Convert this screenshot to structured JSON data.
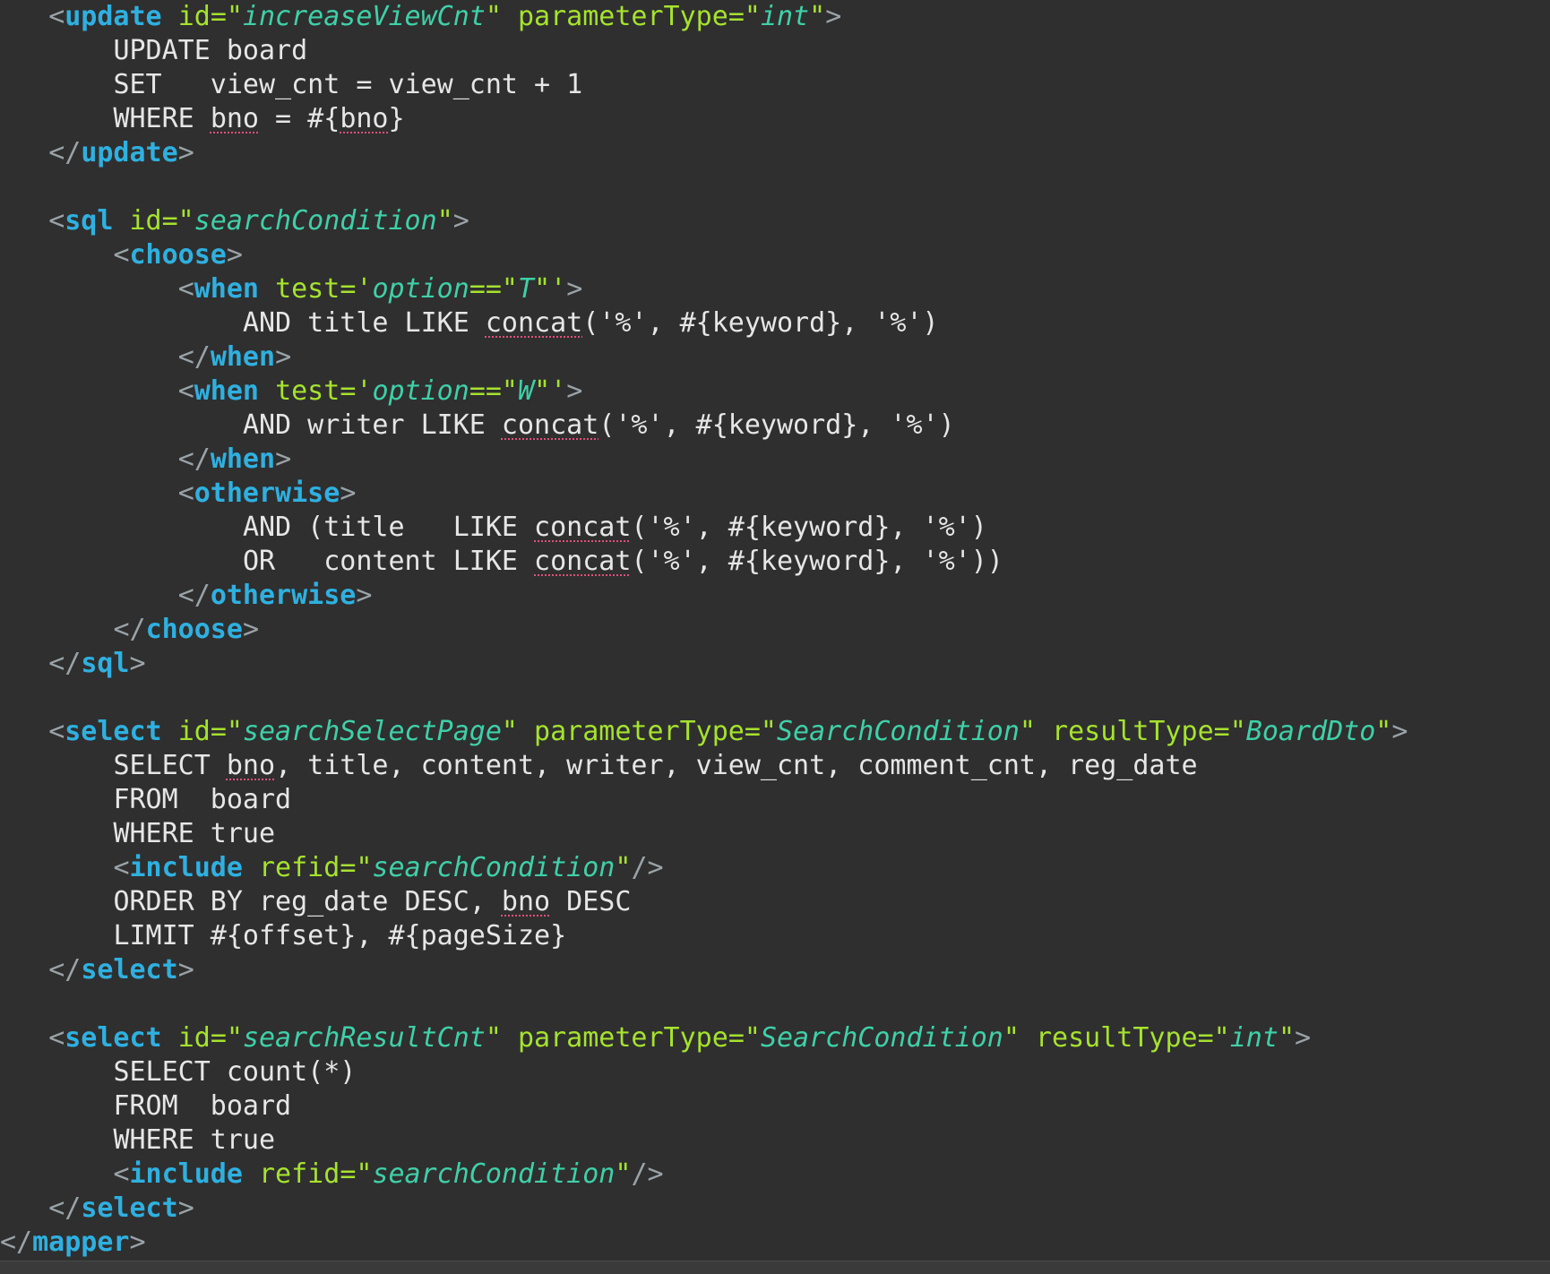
{
  "editor": {
    "theme": {
      "background": "#2f2f2f",
      "tag_color": "#2fb0e0",
      "attr_color": "#a6e22e",
      "value_color": "#3fd0a8",
      "text_color": "#e6e6e6",
      "bracket_color": "#9aa3a8",
      "warning_underline_color": "#e0507a"
    },
    "lines": [
      {
        "indent": 1,
        "tokens": [
          {
            "t": "br",
            "v": "<"
          },
          {
            "t": "tag",
            "v": "update"
          },
          {
            "t": "txt",
            "v": " "
          },
          {
            "t": "attr",
            "v": "id"
          },
          {
            "t": "eq",
            "v": "=\""
          },
          {
            "t": "val",
            "v": "increaseViewCnt"
          },
          {
            "t": "quote",
            "v": "\""
          },
          {
            "t": "txt",
            "v": " "
          },
          {
            "t": "attr",
            "v": "parameterType"
          },
          {
            "t": "eq",
            "v": "=\""
          },
          {
            "t": "val",
            "v": "int"
          },
          {
            "t": "quote",
            "v": "\""
          },
          {
            "t": "br",
            "v": ">"
          }
        ]
      },
      {
        "indent": 2,
        "tokens": [
          {
            "t": "txt",
            "v": "UPDATE board"
          }
        ]
      },
      {
        "indent": 2,
        "tokens": [
          {
            "t": "txt",
            "v": "SET   view_cnt = view_cnt + 1"
          }
        ]
      },
      {
        "indent": 2,
        "tokens": [
          {
            "t": "txt",
            "v": "WHERE "
          },
          {
            "t": "warn",
            "v": "bno"
          },
          {
            "t": "txt",
            "v": " = #{"
          },
          {
            "t": "warn",
            "v": "bno"
          },
          {
            "t": "txt",
            "v": "}"
          }
        ]
      },
      {
        "indent": 1,
        "tokens": [
          {
            "t": "br",
            "v": "</"
          },
          {
            "t": "tag",
            "v": "update"
          },
          {
            "t": "br",
            "v": ">"
          }
        ]
      },
      {
        "indent": 0,
        "tokens": []
      },
      {
        "indent": 1,
        "tokens": [
          {
            "t": "br",
            "v": "<"
          },
          {
            "t": "tag",
            "v": "sql"
          },
          {
            "t": "txt",
            "v": " "
          },
          {
            "t": "attr",
            "v": "id"
          },
          {
            "t": "eq",
            "v": "=\""
          },
          {
            "t": "val",
            "v": "searchCondition"
          },
          {
            "t": "quote",
            "v": "\""
          },
          {
            "t": "br",
            "v": ">"
          }
        ]
      },
      {
        "indent": 2,
        "tokens": [
          {
            "t": "br",
            "v": "<"
          },
          {
            "t": "tag",
            "v": "choose"
          },
          {
            "t": "br",
            "v": ">"
          }
        ]
      },
      {
        "indent": 3,
        "tokens": [
          {
            "t": "br",
            "v": "<"
          },
          {
            "t": "tag",
            "v": "when"
          },
          {
            "t": "txt",
            "v": " "
          },
          {
            "t": "attr",
            "v": "test"
          },
          {
            "t": "eq",
            "v": "='"
          },
          {
            "t": "val",
            "v": "option"
          },
          {
            "t": "eq",
            "v": "==\""
          },
          {
            "t": "val",
            "v": "T"
          },
          {
            "t": "eq",
            "v": "\"'"
          },
          {
            "t": "br",
            "v": ">"
          }
        ]
      },
      {
        "indent": 4,
        "tokens": [
          {
            "t": "txt",
            "v": "AND title LIKE "
          },
          {
            "t": "warn",
            "v": "concat"
          },
          {
            "t": "txt",
            "v": "('%', #{keyword}, '%')"
          }
        ]
      },
      {
        "indent": 3,
        "tokens": [
          {
            "t": "br",
            "v": "</"
          },
          {
            "t": "tag",
            "v": "when"
          },
          {
            "t": "br",
            "v": ">"
          }
        ]
      },
      {
        "indent": 3,
        "tokens": [
          {
            "t": "br",
            "v": "<"
          },
          {
            "t": "tag",
            "v": "when"
          },
          {
            "t": "txt",
            "v": " "
          },
          {
            "t": "attr",
            "v": "test"
          },
          {
            "t": "eq",
            "v": "='"
          },
          {
            "t": "val",
            "v": "option"
          },
          {
            "t": "eq",
            "v": "==\""
          },
          {
            "t": "val",
            "v": "W"
          },
          {
            "t": "eq",
            "v": "\"'"
          },
          {
            "t": "br",
            "v": ">"
          }
        ]
      },
      {
        "indent": 4,
        "tokens": [
          {
            "t": "txt",
            "v": "AND writer LIKE "
          },
          {
            "t": "warn",
            "v": "concat"
          },
          {
            "t": "txt",
            "v": "('%', #{keyword}, '%')"
          }
        ]
      },
      {
        "indent": 3,
        "tokens": [
          {
            "t": "br",
            "v": "</"
          },
          {
            "t": "tag",
            "v": "when"
          },
          {
            "t": "br",
            "v": ">"
          }
        ]
      },
      {
        "indent": 3,
        "tokens": [
          {
            "t": "br",
            "v": "<"
          },
          {
            "t": "tag",
            "v": "otherwise"
          },
          {
            "t": "br",
            "v": ">"
          }
        ]
      },
      {
        "indent": 4,
        "tokens": [
          {
            "t": "txt",
            "v": "AND (title   LIKE "
          },
          {
            "t": "warn",
            "v": "concat"
          },
          {
            "t": "txt",
            "v": "('%', #{keyword}, '%')"
          }
        ]
      },
      {
        "indent": 4,
        "tokens": [
          {
            "t": "txt",
            "v": "OR   content LIKE "
          },
          {
            "t": "warn",
            "v": "concat"
          },
          {
            "t": "txt",
            "v": "('%', #{keyword}, '%'))"
          }
        ]
      },
      {
        "indent": 3,
        "tokens": [
          {
            "t": "br",
            "v": "</"
          },
          {
            "t": "tag",
            "v": "otherwise"
          },
          {
            "t": "br",
            "v": ">"
          }
        ]
      },
      {
        "indent": 2,
        "tokens": [
          {
            "t": "br",
            "v": "</"
          },
          {
            "t": "tag",
            "v": "choose"
          },
          {
            "t": "br",
            "v": ">"
          }
        ]
      },
      {
        "indent": 1,
        "tokens": [
          {
            "t": "br",
            "v": "</"
          },
          {
            "t": "tag",
            "v": "sql"
          },
          {
            "t": "br",
            "v": ">"
          }
        ]
      },
      {
        "indent": 0,
        "tokens": []
      },
      {
        "indent": 1,
        "tokens": [
          {
            "t": "br",
            "v": "<"
          },
          {
            "t": "tag",
            "v": "select"
          },
          {
            "t": "txt",
            "v": " "
          },
          {
            "t": "attr",
            "v": "id"
          },
          {
            "t": "eq",
            "v": "=\""
          },
          {
            "t": "val",
            "v": "searchSelectPage"
          },
          {
            "t": "quote",
            "v": "\""
          },
          {
            "t": "txt",
            "v": " "
          },
          {
            "t": "attr",
            "v": "parameterType"
          },
          {
            "t": "eq",
            "v": "=\""
          },
          {
            "t": "val",
            "v": "SearchCondition"
          },
          {
            "t": "quote",
            "v": "\""
          },
          {
            "t": "txt",
            "v": " "
          },
          {
            "t": "attr",
            "v": "resultType"
          },
          {
            "t": "eq",
            "v": "=\""
          },
          {
            "t": "val",
            "v": "BoardDto"
          },
          {
            "t": "quote",
            "v": "\""
          },
          {
            "t": "br",
            "v": ">"
          }
        ]
      },
      {
        "indent": 2,
        "tokens": [
          {
            "t": "txt",
            "v": "SELECT "
          },
          {
            "t": "warn",
            "v": "bno"
          },
          {
            "t": "txt",
            "v": ", title, content, writer, view_cnt, comment_cnt, reg_date"
          }
        ]
      },
      {
        "indent": 2,
        "tokens": [
          {
            "t": "txt",
            "v": "FROM  board"
          }
        ]
      },
      {
        "indent": 2,
        "tokens": [
          {
            "t": "txt",
            "v": "WHERE true"
          }
        ]
      },
      {
        "indent": 2,
        "tokens": [
          {
            "t": "br",
            "v": "<"
          },
          {
            "t": "tag",
            "v": "include"
          },
          {
            "t": "txt",
            "v": " "
          },
          {
            "t": "attr",
            "v": "refid"
          },
          {
            "t": "eq",
            "v": "=\""
          },
          {
            "t": "val",
            "v": "searchCondition"
          },
          {
            "t": "quote",
            "v": "\""
          },
          {
            "t": "br",
            "v": "/>"
          }
        ]
      },
      {
        "indent": 2,
        "tokens": [
          {
            "t": "txt",
            "v": "ORDER BY reg_date DESC, "
          },
          {
            "t": "warn",
            "v": "bno"
          },
          {
            "t": "txt",
            "v": " DESC"
          }
        ]
      },
      {
        "indent": 2,
        "tokens": [
          {
            "t": "txt",
            "v": "LIMIT #{offset}, #{pageSize}"
          }
        ]
      },
      {
        "indent": 1,
        "tokens": [
          {
            "t": "br",
            "v": "</"
          },
          {
            "t": "tag",
            "v": "select"
          },
          {
            "t": "br",
            "v": ">"
          }
        ]
      },
      {
        "indent": 0,
        "tokens": []
      },
      {
        "indent": 1,
        "tokens": [
          {
            "t": "br",
            "v": "<"
          },
          {
            "t": "tag",
            "v": "select"
          },
          {
            "t": "txt",
            "v": " "
          },
          {
            "t": "attr",
            "v": "id"
          },
          {
            "t": "eq",
            "v": "=\""
          },
          {
            "t": "val",
            "v": "searchResultCnt"
          },
          {
            "t": "quote",
            "v": "\""
          },
          {
            "t": "txt",
            "v": " "
          },
          {
            "t": "attr",
            "v": "parameterType"
          },
          {
            "t": "eq",
            "v": "=\""
          },
          {
            "t": "val",
            "v": "SearchCondition"
          },
          {
            "t": "quote",
            "v": "\""
          },
          {
            "t": "txt",
            "v": " "
          },
          {
            "t": "attr",
            "v": "resultType"
          },
          {
            "t": "eq",
            "v": "=\""
          },
          {
            "t": "val",
            "v": "int"
          },
          {
            "t": "quote",
            "v": "\""
          },
          {
            "t": "br",
            "v": ">"
          }
        ]
      },
      {
        "indent": 2,
        "tokens": [
          {
            "t": "txt",
            "v": "SELECT count(*)"
          }
        ]
      },
      {
        "indent": 2,
        "tokens": [
          {
            "t": "txt",
            "v": "FROM  board"
          }
        ]
      },
      {
        "indent": 2,
        "tokens": [
          {
            "t": "txt",
            "v": "WHERE true"
          }
        ]
      },
      {
        "indent": 2,
        "tokens": [
          {
            "t": "br",
            "v": "<"
          },
          {
            "t": "tag",
            "v": "include"
          },
          {
            "t": "txt",
            "v": " "
          },
          {
            "t": "attr",
            "v": "refid"
          },
          {
            "t": "eq",
            "v": "=\""
          },
          {
            "t": "val",
            "v": "searchCondition"
          },
          {
            "t": "quote",
            "v": "\""
          },
          {
            "t": "br",
            "v": "/>"
          }
        ]
      },
      {
        "indent": 1,
        "tokens": [
          {
            "t": "br",
            "v": "</"
          },
          {
            "t": "tag",
            "v": "select"
          },
          {
            "t": "br",
            "v": ">"
          }
        ]
      },
      {
        "indent": 0,
        "tokens": [
          {
            "t": "br",
            "v": "</"
          },
          {
            "t": "tag",
            "v": "mapper"
          },
          {
            "t": "br",
            "v": ">"
          }
        ]
      }
    ]
  }
}
